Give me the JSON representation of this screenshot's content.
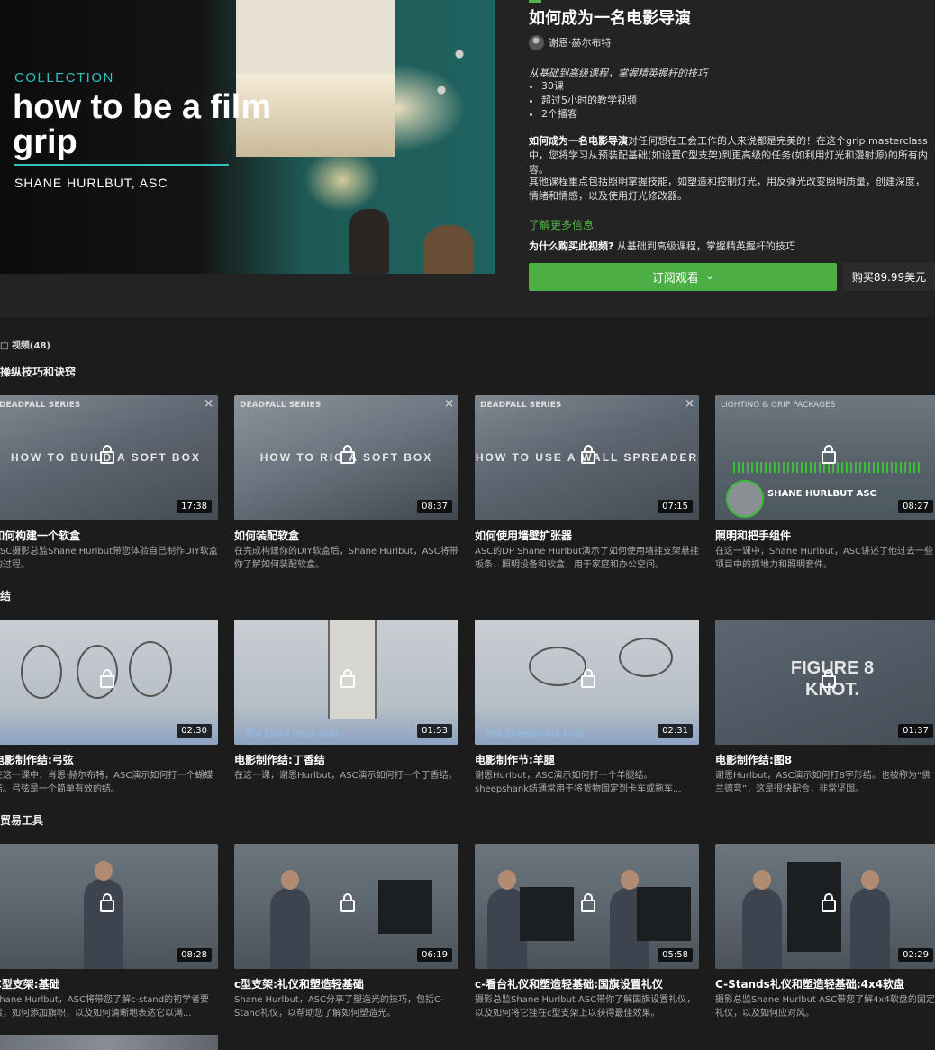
{
  "hero": {
    "collection": "COLLECTION",
    "title": "how to be a film grip",
    "author": "SHANE HURLBUT, ASC"
  },
  "course": {
    "title": "如何成为一名电影导演",
    "instructor": "谢恩·赫尔布特",
    "summary": "从基础到高级课程，掌握精英握杆的技巧",
    "bullets": [
      "30课",
      "超过5小时的教学视频",
      "2个播客"
    ],
    "desc1_bold": "如何成为一名电影导演",
    "desc1_rest": "对任何想在工会工作的人来说都是完美的！在这个grip masterclass中，您将学习从预装配基础(如设置C型支架)到更高级的任务(如利用灯光和漫射源)的所有内容。",
    "desc2": "其他课程重点包括照明掌握技能，如塑造和控制灯光，用反弹光改变照明质量，创建深度，情绪和情感，以及使用灯光修改器。",
    "learn_more": "了解更多信息",
    "why_label": "为什么购买此视频?",
    "why_text": "从基础到高级课程，掌握精英握杆的技巧",
    "subscribe_label": "订阅观看",
    "buy_label": "购买89.99美元"
  },
  "videos_count": "视频(48)",
  "sections": [
    {
      "title": "操纵技巧和诀窍",
      "cards": [
        {
          "title": "如何构建一个软盒",
          "desc": "ASC摄影总监Shane Hurlbut带您体验自己制作DIY软盒的过程。",
          "duration": "17:38",
          "series": "DEADFALL SERIES",
          "overlay": "HOW TO BUILD A SOFT BOX"
        },
        {
          "title": "如何装配软盒",
          "desc": "在完成构建你的DIY软盒后，Shane Hurlbut，ASC将带你了解如何装配软盒。",
          "duration": "08:37",
          "series": "DEADFALL SERIES",
          "overlay": "HOW TO RIG A SOFT BOX"
        },
        {
          "title": "如何使用墙壁扩张器",
          "desc": "ASC的DP Shane Hurlbut演示了如何使用墙挂支架悬挂板条、照明设备和软盒，用于家庭和办公空间。",
          "duration": "07:15",
          "series": "DEADFALL SERIES",
          "overlay": "HOW TO USE A WALL SPREADER"
        },
        {
          "title": "照明和把手组件",
          "desc": "在这一课中，Shane Hurlbut，ASC讲述了他过去一些项目中的抓地力和照明套件。",
          "duration": "08:27",
          "series": "LIGHTING & GRIP PACKAGES",
          "overlay": "SHANE HURLBUT ASC"
        }
      ]
    },
    {
      "title": "结",
      "cards": [
        {
          "title": "电影制作结:弓弦",
          "desc": "在这一课中，肖恩·赫尔布特，ASC演示如何打一个蝴蝶结。弓弦是一个简单有效的结。",
          "duration": "02:30",
          "caption": ""
        },
        {
          "title": "电影制作结:丁香结",
          "desc": "在这一课，谢恩Hurlbut，ASC演示如何打一个丁香结。",
          "duration": "01:53",
          "caption": "The Clove Hitch Knot"
        },
        {
          "title": "电影制作节:羊腿",
          "desc": "谢恩Hurlbut，ASC演示如何打一个羊腿结。sheepshank结通常用于将货物固定到卡车或拖车...",
          "duration": "02:31",
          "caption": "The Sheepshank Knot"
        },
        {
          "title": "电影制作结:图8",
          "desc": "谢恩Hurlbut，ASC演示如何打8字形结。也被称为“佛兰德弯”，这是很快配合，非常坚固。",
          "duration": "01:37",
          "caption": "FIGURE 8 KNOT."
        }
      ]
    },
    {
      "title": "贸易工具",
      "cards": [
        {
          "title": "C型支架:基础",
          "desc": "Shane Hurlbut，ASC将带您了解c-stand的初学者要素，如何添加旗帜，以及如何清晰地表达它以满...",
          "duration": "08:28"
        },
        {
          "title": "c型支架:礼仪和塑造轻基础",
          "desc": "Shane Hurlbut，ASC分享了塑造光的技巧，包括C-Stand礼仪，以帮助您了解如何塑造光。",
          "duration": "06:19"
        },
        {
          "title": "c-看台礼仪和塑造轻基础:国旗设置礼仪",
          "desc": "摄影总监Shane Hurlbut ASC带你了解国旗设置礼仪，以及如何将它挂在c型支架上以获得最佳效果。",
          "duration": "05:58"
        },
        {
          "title": "C-Stands礼仪和塑造轻基础:4x4软盘",
          "desc": "摄影总监Shane Hurlbut ASC带您了解4x4软盘的固定礼仪，以及如何应对风。",
          "duration": "02:29"
        }
      ]
    }
  ],
  "colors": {
    "accent_green": "#4caf45",
    "teal": "#2fc0c0",
    "bg": "#1c1c1c"
  }
}
